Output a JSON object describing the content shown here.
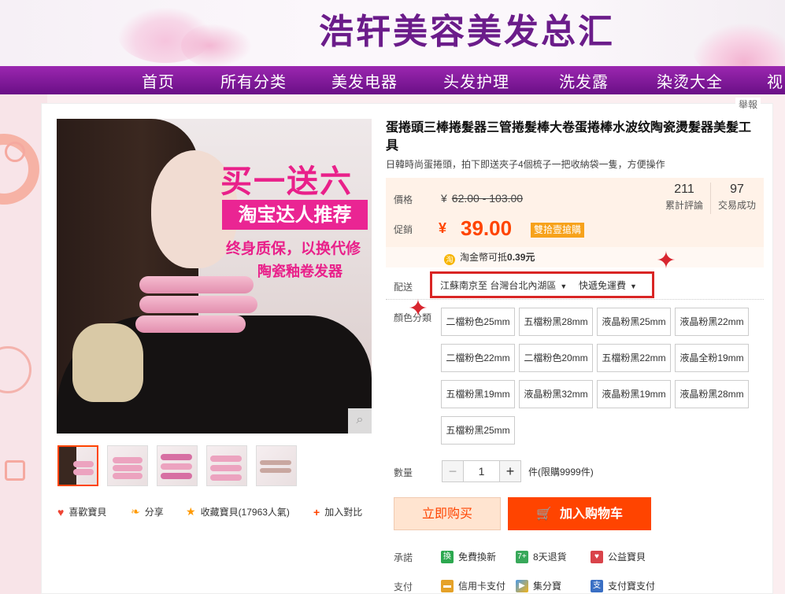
{
  "banner": {
    "title": "浩轩美容美发总汇"
  },
  "nav": {
    "items": [
      "首页",
      "所有分类",
      "美发电器",
      "头发护理",
      "洗发露",
      "染烫大全",
      "视"
    ]
  },
  "report_link": "舉報",
  "main_image": {
    "promo_line1": "买一送六",
    "promo_line2": "淘宝达人推荐",
    "promo_line3": "终身质保，以换代修",
    "promo_line4": "陶瓷釉卷发器"
  },
  "actions": {
    "like": "喜歡寶貝",
    "share": "分享",
    "favorite": "收藏寶貝(17963人氣)",
    "compare": "加入對比"
  },
  "product": {
    "title": "蛋捲頭三棒捲髮器三管捲髮棒大卷蛋捲棒水波纹陶瓷燙髮器美髮工具",
    "subtitle": "日韓時尚蛋捲頭，拍下即送夾子4個梳子一把收納袋一隻，方便操作",
    "price_label": "價格",
    "currency": "¥",
    "original_price": "62.00 - 103.00",
    "promo_label": "促銷",
    "promo_price": "39.00",
    "promo_tag": "雙拾壹搶購",
    "reviews_count": "211",
    "reviews_label": "累計評論",
    "sales_count": "97",
    "sales_label": "交易成功",
    "points_text": "淘金幣可抵",
    "points_value": "0.39元"
  },
  "shipping": {
    "label": "配送",
    "route": "江蘇南京至 台灣台北內湖區",
    "method": "快遞免運費"
  },
  "options": {
    "label": "顏色分類",
    "items": [
      "二檔粉色25mm",
      "五檔粉黑28mm",
      "液晶粉黑25mm",
      "液晶粉黑22mm",
      "二檔粉色22mm",
      "二檔粉色20mm",
      "五檔粉黑22mm",
      "液晶全粉19mm",
      "五檔粉黑19mm",
      "液晶粉黑32mm",
      "液晶粉黑19mm",
      "液晶粉黑28mm",
      "五檔粉黑25mm"
    ]
  },
  "quantity": {
    "label": "數量",
    "minus": "−",
    "value": "1",
    "plus": "+",
    "limit_text": "件(限購9999件)"
  },
  "buttons": {
    "buy": "立即购买",
    "cart": "加入购物车"
  },
  "promise": {
    "label": "承諾",
    "items": [
      "免費換新",
      "8天退貨",
      "公益寶貝"
    ]
  },
  "payment": {
    "label": "支付",
    "items": [
      "信用卡支付",
      "集分寶",
      "支付寶支付"
    ]
  },
  "colors": {
    "accent": "#ff4400",
    "nav": "#7b1a96",
    "highlight_box": "#d92524"
  }
}
